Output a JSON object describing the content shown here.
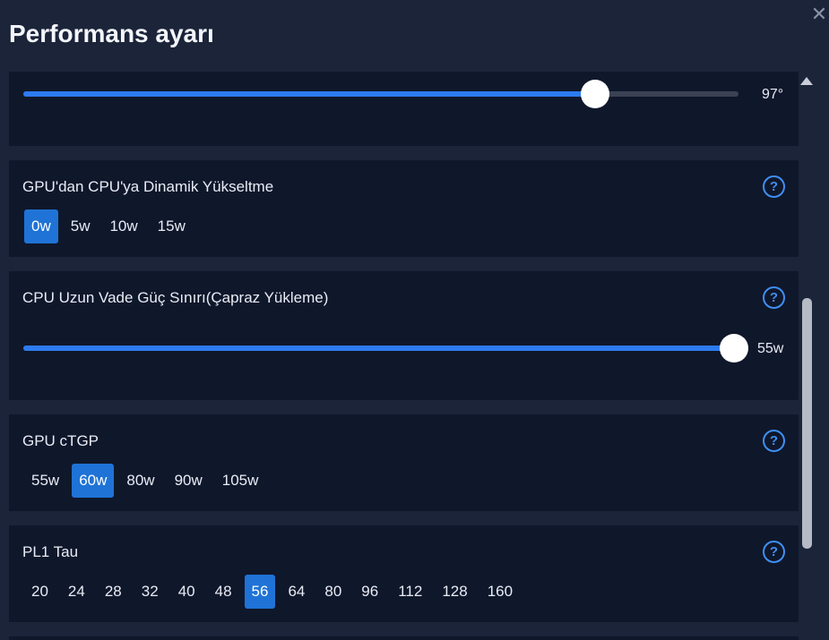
{
  "window": {
    "title": "Performans ayarı",
    "close_icon": "close-icon"
  },
  "temp_limit": {
    "value_label": "97°",
    "value_fraction": 0.8
  },
  "gpu_cpu_boost": {
    "title": "GPU'dan CPU'ya Dinamik Yükseltme",
    "options": [
      "0w",
      "5w",
      "10w",
      "15w"
    ],
    "selected": "0w"
  },
  "cpu_long_power": {
    "title": "CPU Uzun Vade Güç Sınırı(Çapraz Yükleme)",
    "value_label": "55w",
    "value_fraction": 1.0
  },
  "gpu_ctgp": {
    "title": "GPU cTGP",
    "options": [
      "55w",
      "60w",
      "80w",
      "90w",
      "105w"
    ],
    "selected": "60w"
  },
  "pl1_tau": {
    "title": "PL1 Tau",
    "options": [
      "20",
      "24",
      "28",
      "32",
      "40",
      "48",
      "56",
      "64",
      "80",
      "96",
      "112",
      "128",
      "160"
    ],
    "selected": "56"
  },
  "help_icon_glyph": "?",
  "colors": {
    "accent": "#2d7bf0",
    "selected_option": "#1f73d6",
    "card_bg": "#0f172b",
    "window_bg": "#1b2439"
  }
}
